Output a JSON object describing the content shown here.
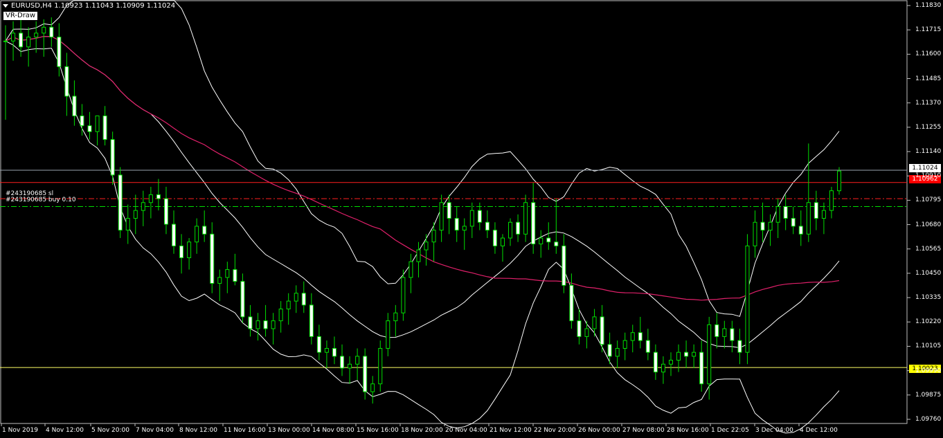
{
  "header": {
    "symbol_text": "EURUSD,H4  1.10923 1.11043 1.10909 1.11024",
    "indicator_label": "VR-Draw"
  },
  "orders": {
    "sl_label": "#243190685 sl",
    "buy_label": "#243190685 buy 0.10"
  },
  "price_tags": {
    "current": "1.11024",
    "red": "1.10962",
    "yellow": "1.10023"
  },
  "colors": {
    "background": "#000000",
    "candle": "#00e000",
    "band": "#ffffff",
    "ma": "#e0206a",
    "hline_grey": "#9aa3b0",
    "hline_red": "#ff2020",
    "hline_yellow": "#ffff66",
    "order_sl": "#ff2020",
    "order_buy": "#00e000",
    "tag_current_bg": "#ffffff",
    "tag_red_bg": "#ff0000",
    "tag_yellow_bg": "#ffff00"
  },
  "axis": {
    "y_ticks": [
      "1.11830",
      "1.11715",
      "1.11600",
      "1.11485",
      "1.11370",
      "1.11255",
      "1.11140",
      "1.10910",
      "1.10795",
      "1.10680",
      "1.10565",
      "1.10450",
      "1.10335",
      "1.10220",
      "1.10105",
      "1.09990",
      "1.09875",
      "1.09760"
    ],
    "x_ticks": [
      "1 Nov 2019",
      "4 Nov 12:00",
      "5 Nov 20:00",
      "7 Nov 04:00",
      "8 Nov 12:00",
      "11 Nov 16:00",
      "13 Nov 00:00",
      "14 Nov 08:00",
      "15 Nov 16:00",
      "18 Nov 20:00",
      "20 Nov 04:00",
      "21 Nov 12:00",
      "22 Nov 20:00",
      "26 Nov 00:00",
      "27 Nov 08:00",
      "28 Nov 16:00",
      "1 Dec 22:05",
      "3 Dec 04:00",
      "4 Dec 12:00"
    ]
  },
  "chart_data": {
    "type": "candlestick",
    "symbol": "EURUSD",
    "timeframe": "H4",
    "last_ohlc": {
      "open": 1.10923,
      "high": 1.11043,
      "low": 1.10909,
      "close": 1.11024
    },
    "ylim": [
      1.0976,
      1.1186
    ],
    "levels": {
      "current": 1.11024,
      "red": 1.10962,
      "yellow": 1.10023,
      "order_sl": 1.1088,
      "order_buy": 1.1084
    },
    "ohlc": [
      [
        1.1168,
        1.1176,
        1.1128,
        1.1168
      ],
      [
        1.1168,
        1.1178,
        1.1158,
        1.1172
      ],
      [
        1.1172,
        1.118,
        1.116,
        1.1165
      ],
      [
        1.1165,
        1.1175,
        1.1155,
        1.117
      ],
      [
        1.117,
        1.1178,
        1.1162,
        1.1172
      ],
      [
        1.1172,
        1.1179,
        1.116,
        1.1175
      ],
      [
        1.1175,
        1.118,
        1.1165,
        1.117
      ],
      [
        1.117,
        1.1177,
        1.115,
        1.1155
      ],
      [
        1.1155,
        1.1162,
        1.113,
        1.114
      ],
      [
        1.114,
        1.1148,
        1.1125,
        1.113
      ],
      [
        1.113,
        1.1136,
        1.112,
        1.1125
      ],
      [
        1.1125,
        1.1132,
        1.1118,
        1.1122
      ],
      [
        1.1122,
        1.113,
        1.1115,
        1.113
      ],
      [
        1.113,
        1.1135,
        1.1115,
        1.1118
      ],
      [
        1.1118,
        1.1122,
        1.1095,
        1.11
      ],
      [
        1.11,
        1.1104,
        1.1068,
        1.1072
      ],
      [
        1.1072,
        1.1085,
        1.1065,
        1.1078
      ],
      [
        1.1078,
        1.109,
        1.107,
        1.1082
      ],
      [
        1.1082,
        1.1092,
        1.1074,
        1.1086
      ],
      [
        1.1086,
        1.1094,
        1.1078,
        1.109
      ],
      [
        1.109,
        1.1098,
        1.1082,
        1.1088
      ],
      [
        1.1088,
        1.1094,
        1.107,
        1.1075
      ],
      [
        1.1075,
        1.1082,
        1.106,
        1.1064
      ],
      [
        1.1064,
        1.107,
        1.105,
        1.1058
      ],
      [
        1.1058,
        1.1068,
        1.1052,
        1.1066
      ],
      [
        1.1066,
        1.1078,
        1.106,
        1.1074
      ],
      [
        1.1074,
        1.1082,
        1.1066,
        1.107
      ],
      [
        1.107,
        1.1076,
        1.104,
        1.1045
      ],
      [
        1.1045,
        1.1052,
        1.1036,
        1.1048
      ],
      [
        1.1048,
        1.1056,
        1.104,
        1.1052
      ],
      [
        1.1052,
        1.106,
        1.1044,
        1.1046
      ],
      [
        1.1046,
        1.105,
        1.1025,
        1.1028
      ],
      [
        1.1028,
        1.1034,
        1.1018,
        1.1022
      ],
      [
        1.1022,
        1.103,
        1.1016,
        1.1026
      ],
      [
        1.1026,
        1.1034,
        1.1018,
        1.1022
      ],
      [
        1.1022,
        1.103,
        1.1014,
        1.1026
      ],
      [
        1.1026,
        1.1036,
        1.102,
        1.1032
      ],
      [
        1.1032,
        1.104,
        1.1024,
        1.1036
      ],
      [
        1.1036,
        1.1044,
        1.103,
        1.104
      ],
      [
        1.104,
        1.1046,
        1.103,
        1.1034
      ],
      [
        1.1034,
        1.104,
        1.1014,
        1.1018
      ],
      [
        1.1018,
        1.1024,
        1.1006,
        1.101
      ],
      [
        1.101,
        1.1016,
        1.1002,
        1.1012
      ],
      [
        1.1012,
        1.1018,
        1.1004,
        1.1008
      ],
      [
        1.1008,
        1.1014,
        1.0998,
        1.1002
      ],
      [
        1.1002,
        1.1008,
        1.0994,
        1.1004
      ],
      [
        1.1004,
        1.1012,
        1.0996,
        1.1008
      ],
      [
        1.1008,
        1.1012,
        1.0986,
        1.099
      ],
      [
        1.099,
        1.0998,
        1.0984,
        1.0994
      ],
      [
        1.0994,
        1.1016,
        1.099,
        1.1012
      ],
      [
        1.1012,
        1.103,
        1.1008,
        1.1026
      ],
      [
        1.1026,
        1.1034,
        1.1018,
        1.103
      ],
      [
        1.103,
        1.1052,
        1.1026,
        1.1048
      ],
      [
        1.1048,
        1.106,
        1.104,
        1.1056
      ],
      [
        1.1056,
        1.1066,
        1.1048,
        1.1062
      ],
      [
        1.1062,
        1.107,
        1.1054,
        1.1066
      ],
      [
        1.1066,
        1.1076,
        1.1056,
        1.1072
      ],
      [
        1.1072,
        1.109,
        1.1066,
        1.1086
      ],
      [
        1.1086,
        1.109,
        1.107,
        1.1078
      ],
      [
        1.1078,
        1.1084,
        1.1066,
        1.1072
      ],
      [
        1.1072,
        1.1078,
        1.1062,
        1.1074
      ],
      [
        1.1074,
        1.1086,
        1.1068,
        1.1082
      ],
      [
        1.1082,
        1.1086,
        1.1072,
        1.1076
      ],
      [
        1.1076,
        1.1082,
        1.1068,
        1.1072
      ],
      [
        1.1072,
        1.1076,
        1.106,
        1.1064
      ],
      [
        1.1064,
        1.107,
        1.1056,
        1.1068
      ],
      [
        1.1068,
        1.1078,
        1.1064,
        1.1076
      ],
      [
        1.1076,
        1.108,
        1.1066,
        1.107
      ],
      [
        1.107,
        1.109,
        1.1066,
        1.1086
      ],
      [
        1.1086,
        1.1096,
        1.106,
        1.1065
      ],
      [
        1.1065,
        1.1072,
        1.1058,
        1.1068
      ],
      [
        1.1068,
        1.1076,
        1.1062,
        1.1066
      ],
      [
        1.1066,
        1.1088,
        1.106,
        1.1064
      ],
      [
        1.1064,
        1.107,
        1.104,
        1.1044
      ],
      [
        1.1044,
        1.105,
        1.1022,
        1.1026
      ],
      [
        1.1026,
        1.1032,
        1.1014,
        1.1018
      ],
      [
        1.1018,
        1.1026,
        1.1012,
        1.1022
      ],
      [
        1.1022,
        1.1032,
        1.1018,
        1.1028
      ],
      [
        1.1028,
        1.1034,
        1.101,
        1.1014
      ],
      [
        1.1014,
        1.102,
        1.1004,
        1.1008
      ],
      [
        1.1008,
        1.1016,
        1.1002,
        1.1012
      ],
      [
        1.1012,
        1.102,
        1.1006,
        1.1016
      ],
      [
        1.1016,
        1.1024,
        1.101,
        1.102
      ],
      [
        1.102,
        1.1028,
        1.1012,
        1.1016
      ],
      [
        1.1016,
        1.1022,
        1.1006,
        1.101
      ],
      [
        1.101,
        1.1014,
        1.0996,
        1.1
      ],
      [
        1.1,
        1.1008,
        1.0994,
        1.1004
      ],
      [
        1.1004,
        1.101,
        1.0998,
        1.1006
      ],
      [
        1.1006,
        1.1014,
        1.1,
        1.101
      ],
      [
        1.101,
        1.1016,
        1.1002,
        1.1008
      ],
      [
        1.1008,
        1.1014,
        1.1002,
        1.101
      ],
      [
        1.101,
        1.1016,
        1.099,
        1.0994
      ],
      [
        1.0994,
        1.1028,
        1.0986,
        1.1024
      ],
      [
        1.1024,
        1.103,
        1.1012,
        1.1018
      ],
      [
        1.1018,
        1.1026,
        1.1012,
        1.1022
      ],
      [
        1.1022,
        1.1026,
        1.101,
        1.1016
      ],
      [
        1.1016,
        1.1022,
        1.1004,
        1.101
      ],
      [
        1.101,
        1.107,
        1.1004,
        1.1064
      ],
      [
        1.1064,
        1.1082,
        1.1058,
        1.1076
      ],
      [
        1.1076,
        1.1086,
        1.1066,
        1.1072
      ],
      [
        1.1072,
        1.108,
        1.1064,
        1.1076
      ],
      [
        1.1076,
        1.1088,
        1.1068,
        1.1084
      ],
      [
        1.1084,
        1.109,
        1.1072,
        1.1078
      ],
      [
        1.1078,
        1.1084,
        1.107,
        1.1074
      ],
      [
        1.1074,
        1.1082,
        1.1064,
        1.107
      ],
      [
        1.107,
        1.1116,
        1.1066,
        1.1086
      ],
      [
        1.1086,
        1.1092,
        1.1072,
        1.1078
      ],
      [
        1.1078,
        1.1086,
        1.107,
        1.1082
      ],
      [
        1.1082,
        1.1094,
        1.1078,
        1.1092
      ],
      [
        1.1092,
        1.1104,
        1.109,
        1.1102
      ]
    ]
  }
}
